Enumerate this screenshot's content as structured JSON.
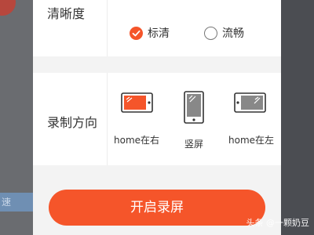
{
  "background": {
    "text_fragment": "速"
  },
  "settings": {
    "clarity": {
      "label": "清晰度",
      "options": [
        {
          "label": "标清",
          "selected": true
        },
        {
          "label": "流畅",
          "selected": false
        }
      ]
    },
    "orientation": {
      "label": "录制方向",
      "options": [
        {
          "label": "home在右",
          "icon": "phone-landscape-right-icon",
          "selected": true
        },
        {
          "label": "竖屏",
          "icon": "phone-portrait-icon",
          "selected": false
        },
        {
          "label": "home在左",
          "icon": "phone-landscape-left-icon",
          "selected": false
        }
      ]
    }
  },
  "start_button": {
    "label": "开启录屏"
  },
  "watermark": "头条 @一颗奶豆",
  "colors": {
    "accent": "#f5552a",
    "inactive": "#555555"
  }
}
